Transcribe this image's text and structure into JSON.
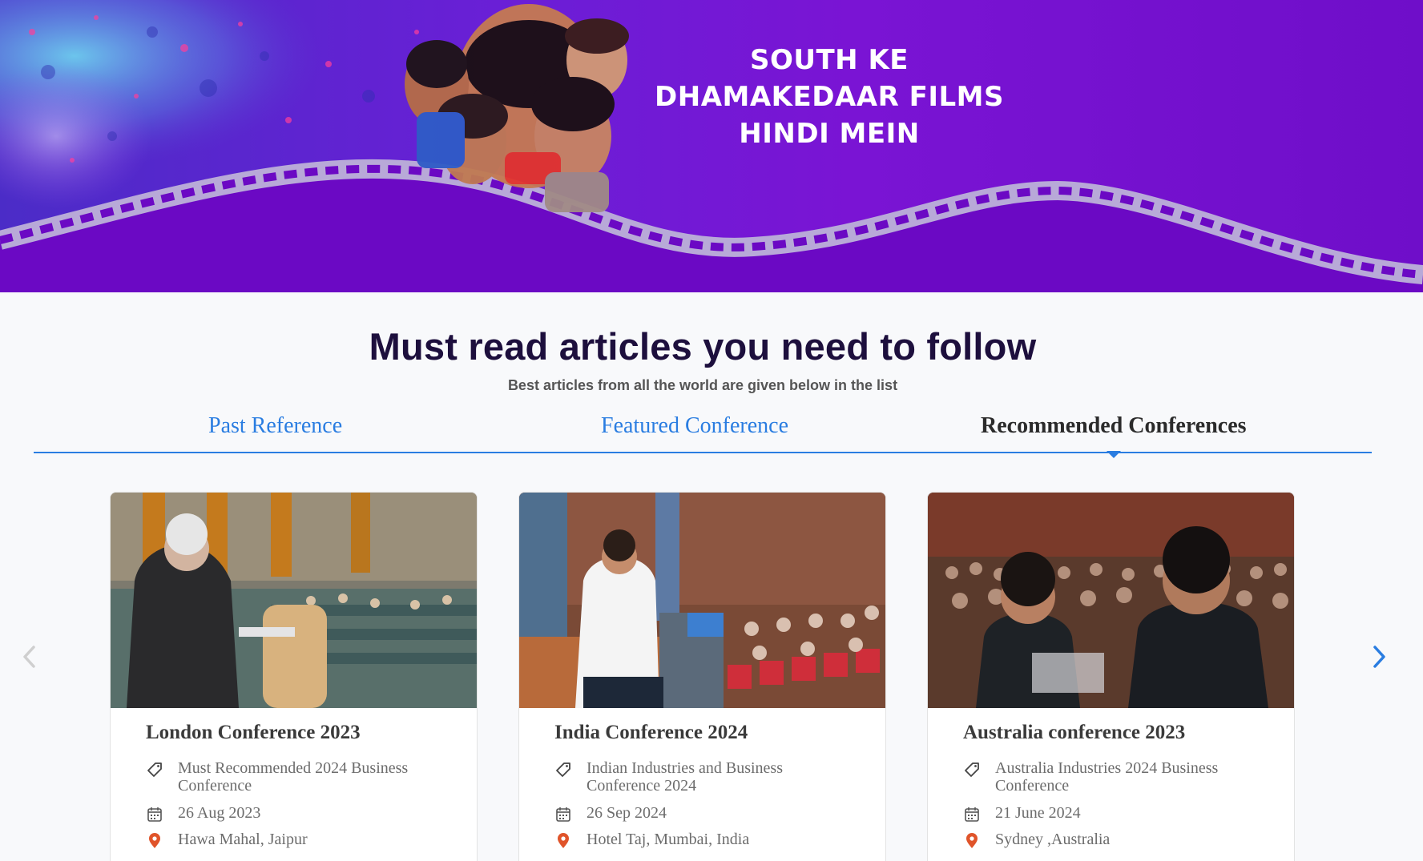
{
  "banner": {
    "lines": [
      "SOUTH KE",
      "DHAMAKEDAAR FILMS",
      "HINDI MEIN"
    ]
  },
  "section": {
    "title": "Must read articles you need to follow",
    "subtitle": "Best articles from all the world are given below in the list"
  },
  "tabs": [
    {
      "label": "Past Reference",
      "active": false
    },
    {
      "label": "Featured Conference",
      "active": false
    },
    {
      "label": "Recommended Conferences",
      "active": true
    }
  ],
  "carousel": {
    "prev_icon": "chevron-left-icon",
    "next_icon": "chevron-right-icon",
    "accent_color": "#2a7de1",
    "inactive_arrow_color": "#cfcfcf"
  },
  "cards": [
    {
      "title": "London Conference 2023",
      "category": " Must Recommended 2024 Business Conference",
      "date": "26 Aug 2023",
      "location": " Hawa Mahal, Jaipur"
    },
    {
      "title": "India Conference 2024",
      "category": "Indian Industries and Business Conference 2024",
      "date": "26 Sep 2024",
      "location": "Hotel Taj, Mumbai, India"
    },
    {
      "title": "Australia conference 2023",
      "category": " Australia Industries 2024 Business Conference",
      "date": "21 June 2024",
      "location": " Sydney ,Australia"
    }
  ],
  "icons": {
    "tag": "tag-icon",
    "date": "calendar-icon",
    "location": "map-pin-icon",
    "location_color": "#e0542a"
  }
}
